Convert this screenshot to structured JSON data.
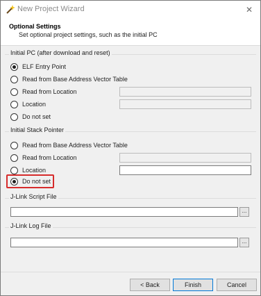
{
  "window": {
    "title": "New Project Wizard",
    "close_glyph": "✕"
  },
  "header": {
    "title": "Optional Settings",
    "subtitle": "Set optional project settings, such as the initial PC"
  },
  "initial_pc": {
    "label": "Initial PC (after download and reset)",
    "options": [
      {
        "label": "ELF Entry Point",
        "checked": true
      },
      {
        "label": "Read from Base Address Vector Table",
        "checked": false
      },
      {
        "label": "Read from Location",
        "checked": false
      },
      {
        "label": "Location",
        "checked": false
      },
      {
        "label": "Do not set",
        "checked": false
      }
    ]
  },
  "initial_sp": {
    "label": "Initial Stack Pointer",
    "options": [
      {
        "label": "Read from Base Address Vector Table",
        "checked": false
      },
      {
        "label": "Read from Location",
        "checked": false
      },
      {
        "label": "Location",
        "checked": false
      },
      {
        "label": "Do not set",
        "checked": true
      }
    ]
  },
  "jlink_script": {
    "label": "J-Link Script File",
    "value": "",
    "browse_label": "..."
  },
  "jlink_log": {
    "label": "J-Link Log File",
    "value": "",
    "browse_label": "..."
  },
  "buttons": {
    "back": "< Back",
    "finish": "Finish",
    "cancel": "Cancel"
  },
  "colors": {
    "highlight": "#d62b2b",
    "default_button_border": "#0078d7"
  },
  "icons": {
    "title": "wand-icon",
    "close": "close-icon",
    "radio": "radio-icon"
  }
}
